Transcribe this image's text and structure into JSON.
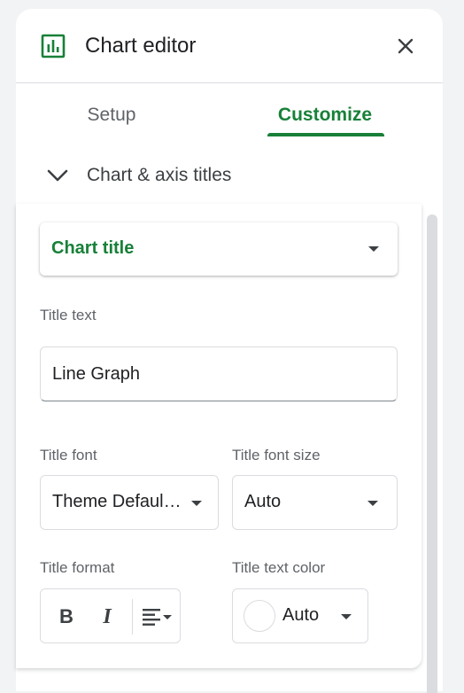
{
  "header": {
    "title": "Chart editor",
    "icon": "chart-icon",
    "close_icon": "close-icon",
    "accent_color": "#188038"
  },
  "tabs": [
    {
      "label": "Setup",
      "active": false
    },
    {
      "label": "Customize",
      "active": true
    }
  ],
  "section": {
    "title": "Chart & axis titles",
    "expanded": true
  },
  "chart_titles": {
    "target": {
      "selected": "Chart title"
    },
    "title_text": {
      "label": "Title text",
      "value": "Line Graph"
    },
    "title_font": {
      "label": "Title font",
      "value": "Theme Defaul…"
    },
    "title_font_size": {
      "label": "Title font size",
      "value": "Auto"
    },
    "title_format": {
      "label": "Title format",
      "bold": "B",
      "italic": "I",
      "align_icon": "align-left-icon"
    },
    "title_text_color": {
      "label": "Title text color",
      "value": "Auto",
      "swatch": "#ffffff"
    }
  }
}
